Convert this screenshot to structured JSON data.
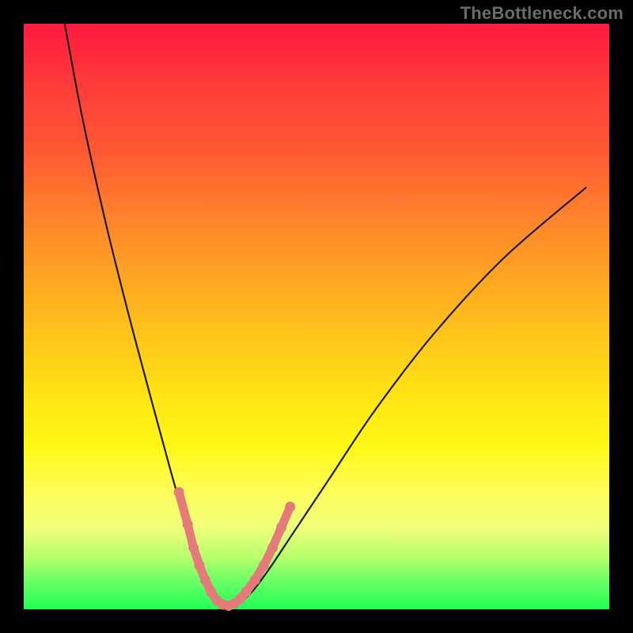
{
  "watermark": "TheBottleneck.com",
  "colors": {
    "gradient_top": "#ff193f",
    "gradient_bottom": "#1fff57",
    "curve": "#1c1c1c",
    "markers": "#e47a7a",
    "background": "#000000"
  },
  "chart_data": {
    "type": "line",
    "title": "",
    "xlabel": "",
    "ylabel": "",
    "xlim": [
      0,
      100
    ],
    "ylim": [
      0,
      100
    ],
    "notes": "V-shaped bottleneck curve; markers clustered near the minimum. No axis tick labels visible.",
    "series": [
      {
        "name": "bottleneck-curve",
        "x": [
          7,
          10,
          14,
          18,
          22,
          25,
          27,
          29,
          31,
          32.5,
          34,
          35.5,
          37,
          39,
          42,
          46,
          52,
          60,
          70,
          82,
          96
        ],
        "y": [
          100,
          84,
          66,
          50,
          35,
          24,
          17,
          11,
          6,
          3,
          1.2,
          0.5,
          1.2,
          3,
          7,
          13,
          22,
          34,
          47,
          60,
          72
        ]
      },
      {
        "name": "markers",
        "x": [
          26.5,
          28,
          29,
          30,
          31,
          32,
          33,
          34,
          35,
          36,
          37,
          38,
          39.5,
          41,
          42.5,
          44,
          45.5
        ],
        "y": [
          20,
          14.5,
          10.5,
          7.5,
          5,
          3,
          1.5,
          0.8,
          0.6,
          1,
          1.8,
          3,
          5,
          7.5,
          10.5,
          14,
          17.5
        ]
      }
    ]
  }
}
